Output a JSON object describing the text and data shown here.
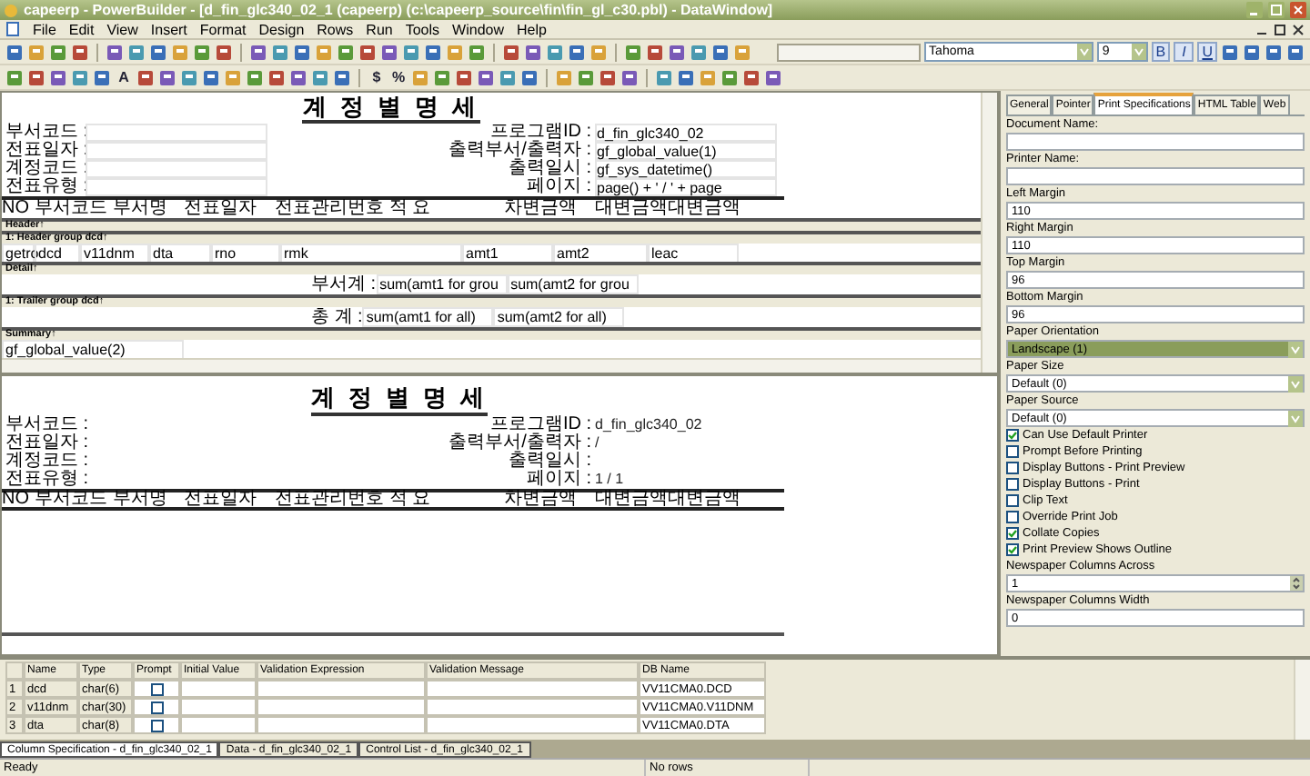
{
  "window": {
    "title": "capeerp - PowerBuilder - [d_fin_glc340_02_1  (capeerp) (c:\\capeerp_source\\fin\\fin_gl_c30.pbl) - DataWindow]"
  },
  "menu": [
    "File",
    "Edit",
    "View",
    "Insert",
    "Format",
    "Design",
    "Rows",
    "Run",
    "Tools",
    "Window",
    "Help"
  ],
  "toolbar": {
    "text_letter": "A",
    "symbols": [
      "$",
      "%"
    ],
    "font": "Tahoma",
    "size": "9",
    "styles": [
      "B",
      "I",
      "U"
    ]
  },
  "design": {
    "title": "계 정 별 명 세",
    "left_fields": [
      "부서코드 :",
      "전표일자 :",
      "계정코드 :",
      "전표유형 :"
    ],
    "right_fields": [
      {
        "label": "프로그램ID :",
        "value": "d_fin_glc340_02"
      },
      {
        "label": "출력부서/출력자 :",
        "value": "gf_global_value(1)"
      },
      {
        "label": "출력일시 :",
        "value": "gf_sys_datetime()"
      },
      {
        "label": "페이지 :",
        "value": "page() + ' / ' + page"
      }
    ],
    "columns": [
      "NO",
      "부서코드 부서명",
      "전표일자",
      "전표관리번호 적 요",
      "차변금액",
      "대변금액",
      "대변금액"
    ],
    "bands": [
      "Header↑",
      "1: Header group dcd↑",
      "Detail↑",
      "1: Trailer group dcd↑",
      "Summary↑"
    ],
    "detail_cells": [
      "getro",
      "dcd",
      "v11dnm",
      "dta",
      "rno",
      "rmk",
      "amt1",
      "amt2",
      "leac"
    ],
    "group_total": {
      "label": "부서계 :",
      "cells": [
        "sum(amt1 for grou",
        "sum(amt2 for grou"
      ]
    },
    "grand_total": {
      "label": "총  계 :",
      "cells": [
        "sum(amt1 for all)",
        "sum(amt2 for all)"
      ]
    },
    "summary_cell": "gf_global_value(2)"
  },
  "preview": {
    "title": "계 정 별 명 세",
    "left_fields": [
      "부서코드 :",
      "전표일자 :",
      "계정코드 :",
      "전표유형 :"
    ],
    "right_fields": [
      {
        "label": "프로그램ID :",
        "value": "d_fin_glc340_02"
      },
      {
        "label": "출력부서/출력자 :",
        "value": "/"
      },
      {
        "label": "출력일시 :"
      },
      {
        "label": "페이지 :",
        "value": "1 / 1"
      }
    ],
    "columns": [
      "NO",
      "부서코드 부서명",
      "전표일자",
      "전표관리번호 적 요",
      "차변금액",
      "대변금액",
      "대변금액"
    ]
  },
  "properties": {
    "tabs": [
      {
        "label": "General",
        "selected": false
      },
      {
        "label": "Pointer",
        "selected": false
      },
      {
        "label": "Print Specifications",
        "selected": true
      },
      {
        "label": "HTML Table",
        "selected": false
      },
      {
        "label": "Web",
        "selected": false
      }
    ],
    "fields": [
      {
        "kind": "text",
        "label": "Document Name:",
        "focused": false
      },
      {
        "kind": "text",
        "label": "Printer Name:",
        "focused": false
      },
      {
        "kind": "text",
        "label": "Left Margin",
        "value": "110",
        "focused": false
      },
      {
        "kind": "text",
        "label": "Right Margin",
        "value": "110",
        "focused": false
      },
      {
        "kind": "text",
        "label": "Top Margin",
        "value": "96",
        "focused": false
      },
      {
        "kind": "text",
        "label": "Bottom Margin",
        "value": "96",
        "focused": false
      },
      {
        "kind": "select",
        "label": "Paper Orientation",
        "value": "Landscape (1)",
        "focused": true
      },
      {
        "kind": "select",
        "label": "Paper Size",
        "value": "Default (0)",
        "focused": false
      },
      {
        "kind": "select",
        "label": "Paper Source",
        "value": "Default (0)",
        "focused": false
      },
      {
        "kind": "check",
        "label": "Can Use Default Printer",
        "checked": true,
        "focused": false
      },
      {
        "kind": "check",
        "label": "Prompt Before Printing",
        "checked": false,
        "focused": false
      },
      {
        "kind": "check",
        "label": "Display Buttons - Print Preview",
        "checked": false,
        "focused": false
      },
      {
        "kind": "check",
        "label": "Display Buttons - Print",
        "checked": false,
        "focused": false
      },
      {
        "kind": "check",
        "label": "Clip Text",
        "checked": false,
        "focused": false
      },
      {
        "kind": "check",
        "label": "Override Print Job",
        "checked": false,
        "focused": false
      },
      {
        "kind": "check",
        "label": "Collate Copies",
        "checked": true,
        "focused": false
      },
      {
        "kind": "check",
        "label": "Print Preview Shows Outline",
        "checked": true,
        "focused": false
      },
      {
        "kind": "spin",
        "label": "Newspaper Columns Across",
        "value": "1",
        "focused": false
      },
      {
        "kind": "text",
        "label": "Newspaper Columns Width",
        "value": "0",
        "focused": false
      }
    ]
  },
  "column_grid": {
    "headers": [
      "Name",
      "Type",
      "Prompt",
      "Initial Value",
      "Validation Expression",
      "Validation Message",
      "DB Name"
    ],
    "rows": [
      {
        "no": "1",
        "name": "dcd",
        "type": "char(6)",
        "prompt": false,
        "db_name": "VV11CMA0.DCD"
      },
      {
        "no": "2",
        "name": "v11dnm",
        "type": "char(30)",
        "prompt": false,
        "db_name": "VV11CMA0.V11DNM"
      },
      {
        "no": "3",
        "name": "dta",
        "type": "char(8)",
        "prompt": false,
        "db_name": "VV11CMA0.DTA"
      }
    ]
  },
  "bottom_tabs": [
    {
      "label": "Column Specification - d_fin_glc340_02_1",
      "selected": true
    },
    {
      "label": "Data - d_fin_glc340_02_1",
      "selected": false
    },
    {
      "label": "Control List - d_fin_glc340_02_1",
      "selected": false
    }
  ],
  "status_bar": [
    "Ready",
    "No rows"
  ]
}
